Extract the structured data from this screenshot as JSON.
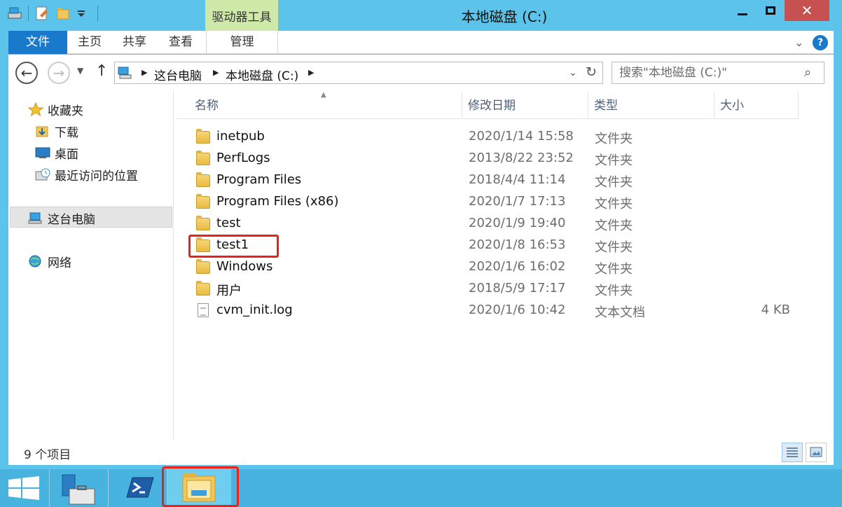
{
  "window": {
    "title": "本地磁盘 (C:)",
    "contextual_tab_header": "驱动器工具",
    "close_glyph": "✕"
  },
  "ribbon": {
    "tabs": [
      "文件",
      "主页",
      "共享",
      "查看",
      "管理"
    ],
    "active_tab": "文件",
    "help_glyph": "?"
  },
  "address": {
    "crumbs": [
      "这台电脑",
      "本地磁盘 (C:)"
    ]
  },
  "search": {
    "placeholder": "搜索\"本地磁盘 (C:)\""
  },
  "nav_pane": {
    "favorites": "收藏夹",
    "downloads": "下载",
    "desktop": "桌面",
    "recent": "最近访问的位置",
    "this_pc": "这台电脑",
    "network": "网络",
    "selected": "这台电脑"
  },
  "columns": [
    "名称",
    "修改日期",
    "类型",
    "大小"
  ],
  "files": [
    {
      "name": "inetpub",
      "date": "2020/1/14 15:58",
      "type": "文件夹",
      "size": "",
      "icon": "folder-icon"
    },
    {
      "name": "PerfLogs",
      "date": "2013/8/22 23:52",
      "type": "文件夹",
      "size": "",
      "icon": "folder-icon"
    },
    {
      "name": "Program Files",
      "date": "2018/4/4 11:14",
      "type": "文件夹",
      "size": "",
      "icon": "folder-icon"
    },
    {
      "name": "Program Files (x86)",
      "date": "2020/1/7 17:13",
      "type": "文件夹",
      "size": "",
      "icon": "folder-icon"
    },
    {
      "name": "test",
      "date": "2020/1/9 19:40",
      "type": "文件夹",
      "size": "",
      "icon": "folder-icon"
    },
    {
      "name": "test1",
      "date": "2020/1/8 16:53",
      "type": "文件夹",
      "size": "",
      "icon": "folder-icon"
    },
    {
      "name": "Windows",
      "date": "2020/1/6 16:02",
      "type": "文件夹",
      "size": "",
      "icon": "folder-icon"
    },
    {
      "name": "用户",
      "date": "2018/5/9 17:17",
      "type": "文件夹",
      "size": "",
      "icon": "folder-icon"
    },
    {
      "name": "cvm_init.log",
      "date": "2020/1/6 10:42",
      "type": "文本文档",
      "size": "4 KB",
      "icon": "text-file-icon"
    }
  ],
  "highlighted_item": "test1",
  "status": {
    "item_count": "9 个项目"
  },
  "taskbar": {
    "items": [
      "start-button",
      "server-manager",
      "powershell",
      "file-explorer"
    ],
    "highlighted": "file-explorer"
  },
  "colors": {
    "titlebar": "#5cc4ea",
    "file_tab": "#1979ca",
    "contextual_tab": "#cfe9a8",
    "highlight": "#e8221b",
    "close_button": "#c75050"
  }
}
